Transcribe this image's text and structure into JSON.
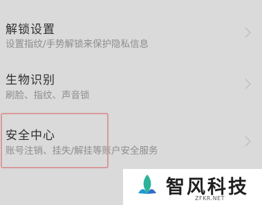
{
  "settings": {
    "items": [
      {
        "title": "解锁设置",
        "subtitle": "设置指纹/手势解锁来保护隐私信息"
      },
      {
        "title": "生物识别",
        "subtitle": "刷脸、指纹、声音锁"
      },
      {
        "title": "安全中心",
        "subtitle": "账号注销、挂失/解挂等账户安全服务"
      }
    ],
    "chevron_icon": "chevron-right-icon"
  },
  "highlight": {
    "target": "安全中心",
    "color": "#d79a9a"
  },
  "watermark": {
    "brand": "智风科技",
    "domain": "ZFKR.NET",
    "logo_icon": "leaf-logo-icon",
    "logo_colors": [
      "#2bb39a",
      "#1f9bd1",
      "#2f6fc8"
    ]
  },
  "colors": {
    "background": "#dadada",
    "title": "#2f2f2f",
    "subtitle": "#8d8d8d"
  }
}
